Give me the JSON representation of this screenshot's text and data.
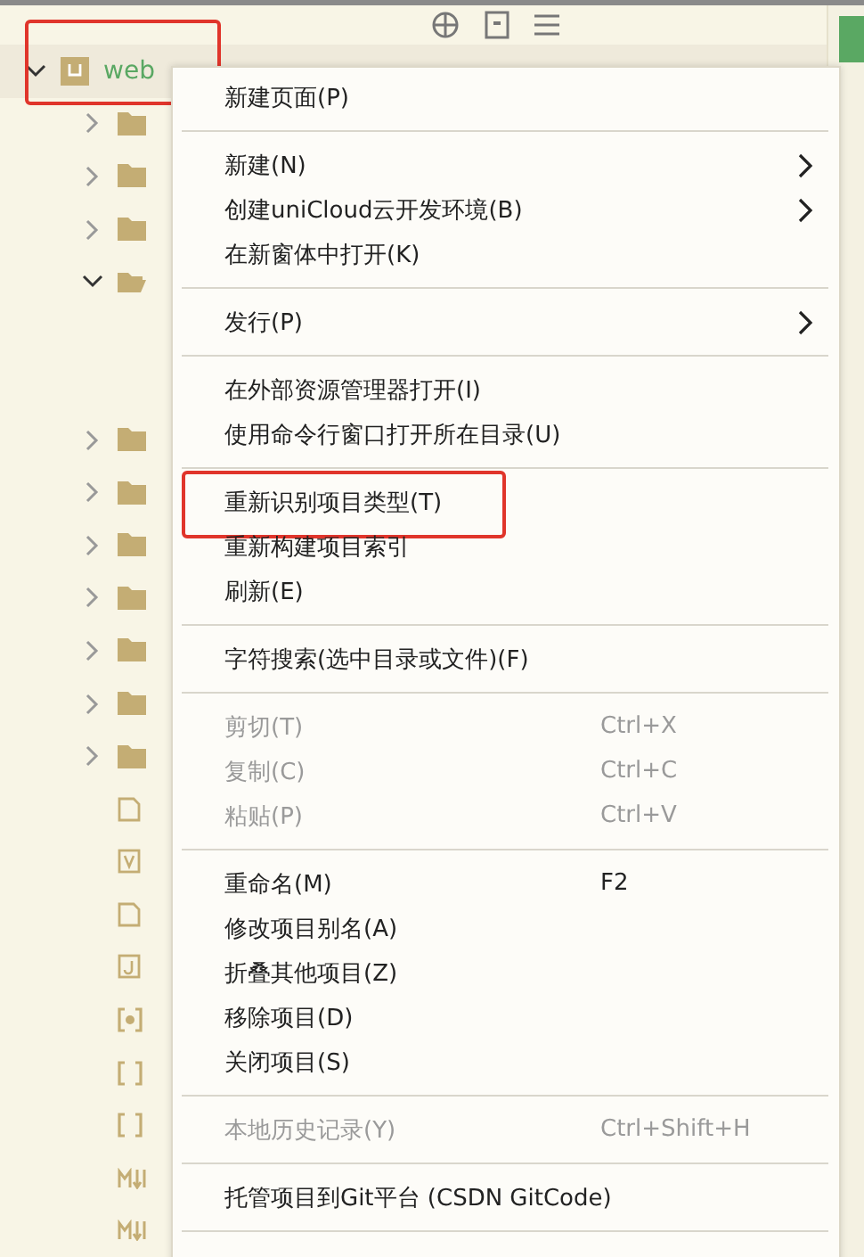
{
  "tree": {
    "root": {
      "label": "web",
      "expanded": true,
      "annotated": true
    },
    "children": [
      {
        "kind": "folder",
        "expanded": false
      },
      {
        "kind": "folder",
        "expanded": false
      },
      {
        "kind": "folder",
        "expanded": false
      },
      {
        "kind": "folder",
        "expanded": true
      },
      {
        "kind": "folder",
        "expanded": false
      },
      {
        "kind": "folder",
        "expanded": false
      },
      {
        "kind": "folder",
        "expanded": false
      },
      {
        "kind": "folder",
        "expanded": false
      },
      {
        "kind": "folder",
        "expanded": false
      },
      {
        "kind": "folder",
        "expanded": false
      },
      {
        "kind": "folder",
        "expanded": false
      },
      {
        "kind": "file"
      },
      {
        "kind": "vue"
      },
      {
        "kind": "file"
      },
      {
        "kind": "js"
      },
      {
        "kind": "config"
      },
      {
        "kind": "json"
      },
      {
        "kind": "json"
      },
      {
        "kind": "md"
      },
      {
        "kind": "md"
      }
    ]
  },
  "context_menu": [
    {
      "kind": "item",
      "label": "新建页面(P)",
      "disabled": false,
      "submenu": false,
      "annotated": false
    },
    {
      "kind": "separator"
    },
    {
      "kind": "item",
      "label": "新建(N)",
      "disabled": false,
      "submenu": true,
      "annotated": false
    },
    {
      "kind": "item",
      "label": "创建uniCloud云开发环境(B)",
      "disabled": false,
      "submenu": true,
      "annotated": false
    },
    {
      "kind": "item",
      "label": "在新窗体中打开(K)",
      "disabled": false,
      "submenu": false,
      "annotated": false
    },
    {
      "kind": "separator"
    },
    {
      "kind": "item",
      "label": "发行(P)",
      "disabled": false,
      "submenu": true,
      "annotated": false
    },
    {
      "kind": "separator"
    },
    {
      "kind": "item",
      "label": "在外部资源管理器打开(I)",
      "disabled": false,
      "submenu": false,
      "annotated": false
    },
    {
      "kind": "item",
      "label": "使用命令行窗口打开所在目录(U)",
      "disabled": false,
      "submenu": false,
      "annotated": false
    },
    {
      "kind": "separator"
    },
    {
      "kind": "item",
      "label": "重新识别项目类型(T)",
      "disabled": false,
      "submenu": false,
      "annotated": true
    },
    {
      "kind": "item",
      "label": "重新构建项目索引",
      "disabled": false,
      "submenu": false,
      "annotated": false
    },
    {
      "kind": "item",
      "label": "刷新(E)",
      "disabled": false,
      "submenu": false,
      "annotated": false
    },
    {
      "kind": "separator"
    },
    {
      "kind": "item",
      "label": "字符搜索(选中目录或文件)(F)",
      "disabled": false,
      "submenu": false,
      "annotated": false
    },
    {
      "kind": "separator"
    },
    {
      "kind": "item",
      "label": "剪切(T)",
      "shortcut": "Ctrl+X",
      "disabled": true,
      "submenu": false,
      "annotated": false
    },
    {
      "kind": "item",
      "label": "复制(C)",
      "shortcut": "Ctrl+C",
      "disabled": true,
      "submenu": false,
      "annotated": false
    },
    {
      "kind": "item",
      "label": "粘贴(P)",
      "shortcut": "Ctrl+V",
      "disabled": true,
      "submenu": false,
      "annotated": false
    },
    {
      "kind": "separator"
    },
    {
      "kind": "item",
      "label": "重命名(M)",
      "shortcut": "F2",
      "disabled": false,
      "submenu": false,
      "annotated": false
    },
    {
      "kind": "item",
      "label": "修改项目别名(A)",
      "disabled": false,
      "submenu": false,
      "annotated": false
    },
    {
      "kind": "item",
      "label": "折叠其他项目(Z)",
      "disabled": false,
      "submenu": false,
      "annotated": false
    },
    {
      "kind": "item",
      "label": "移除项目(D)",
      "disabled": false,
      "submenu": false,
      "annotated": false
    },
    {
      "kind": "item",
      "label": "关闭项目(S)",
      "disabled": false,
      "submenu": false,
      "annotated": false
    },
    {
      "kind": "separator"
    },
    {
      "kind": "item",
      "label": "本地历史记录(Y)",
      "shortcut": "Ctrl+Shift+H",
      "disabled": true,
      "submenu": false,
      "annotated": false
    },
    {
      "kind": "separator"
    },
    {
      "kind": "item",
      "label": "托管项目到Git平台 (CSDN GitCode)",
      "disabled": false,
      "submenu": false,
      "annotated": false
    },
    {
      "kind": "separator"
    }
  ]
}
